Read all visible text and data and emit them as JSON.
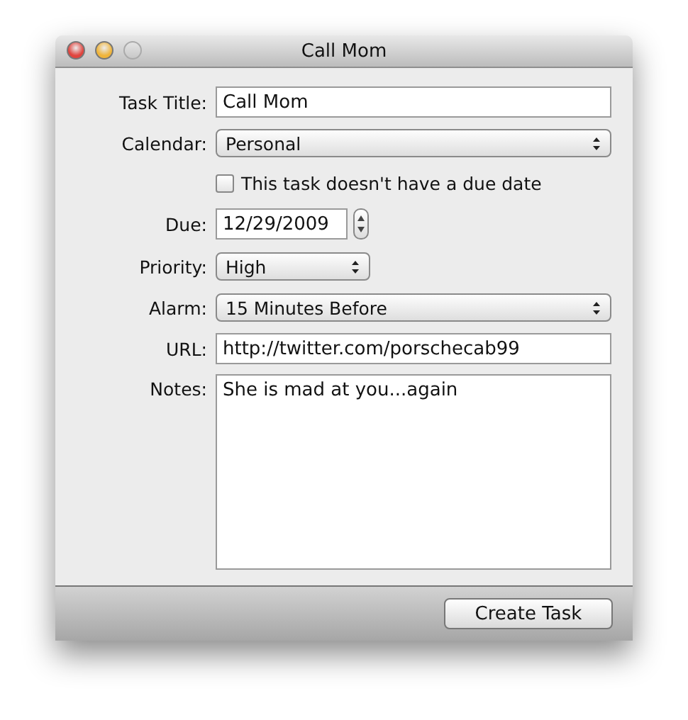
{
  "window": {
    "title": "Call Mom",
    "buttons": [
      {
        "kind": "close",
        "disabled": false
      },
      {
        "kind": "minimize",
        "disabled": false
      },
      {
        "kind": "zoom",
        "disabled": true
      }
    ]
  },
  "rows": [
    {
      "kind": "text",
      "label": "Task Title:",
      "value": "Call Mom"
    },
    {
      "kind": "popup",
      "label": "Calendar:",
      "value": "Personal",
      "wide": true
    },
    {
      "kind": "checkbox",
      "text": "This task doesn't have a due date",
      "checked": false
    },
    {
      "kind": "date",
      "label": "Due:",
      "value": "12/29/2009"
    },
    {
      "kind": "popup",
      "label": "Priority:",
      "value": "High",
      "wide": false
    },
    {
      "kind": "popup",
      "label": "Alarm:",
      "value": "15 Minutes Before",
      "wide": true
    },
    {
      "kind": "text",
      "label": "URL:",
      "value": "http://twitter.com/porschecab99"
    },
    {
      "kind": "notes",
      "label": "Notes:",
      "value": "She is mad at you...again"
    }
  ],
  "button": "Create Task"
}
